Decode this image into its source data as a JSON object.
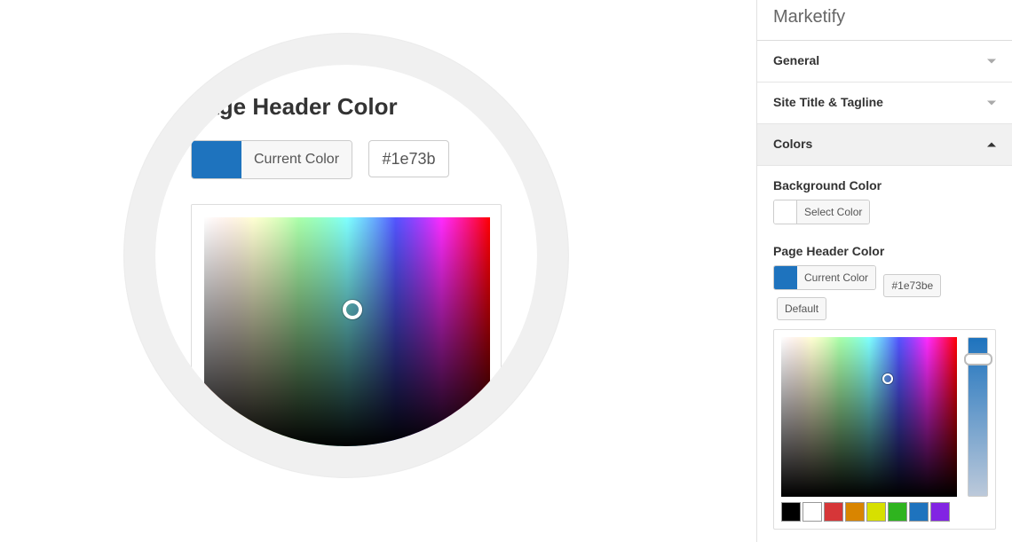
{
  "panel": {
    "title": "Marketify",
    "sections": [
      {
        "label": "General",
        "expanded": false
      },
      {
        "label": "Site Title & Tagline",
        "expanded": false
      },
      {
        "label": "Colors",
        "expanded": true
      }
    ]
  },
  "colors": {
    "bg": {
      "label": "Background Color",
      "select_button": "Select Color",
      "swatch": "#ffffff"
    },
    "header": {
      "label": "Page Header Color",
      "current_button": "Current Color",
      "hex": "#1e73be",
      "default_button": "Default",
      "swatch": "#1e73be"
    }
  },
  "palette": [
    "#000000",
    "#ffffff",
    "#d63638",
    "#d98500",
    "#d7e000",
    "#2fb41f",
    "#1e73be",
    "#8224e3"
  ],
  "zoom": {
    "title": "Page Header Color",
    "current_button": "Current Color",
    "hex_visible": "#1e73b",
    "swatch": "#1e73be"
  }
}
